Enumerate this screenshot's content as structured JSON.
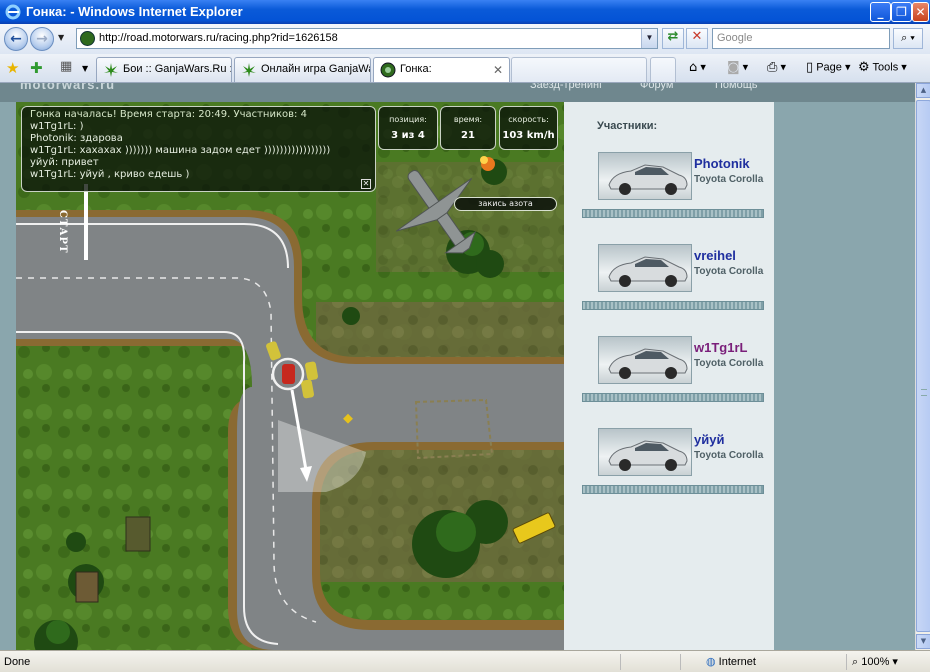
{
  "window": {
    "title": "Гонка: - Windows Internet Explorer"
  },
  "address": {
    "url": "http://road.motorwars.ru/racing.php?rid=1626158"
  },
  "search": {
    "placeholder": "Google"
  },
  "tabs": [
    {
      "label": "Бои :: GanjaWars.Ru ::...",
      "active": false
    },
    {
      "label": "Онлайн игра GanjaWa...",
      "active": false
    },
    {
      "label": "Гонка:",
      "active": true
    }
  ],
  "commands": {
    "page": "Page",
    "tools": "Tools"
  },
  "site": {
    "logo": "motorwars.ru",
    "links": [
      "Заезд-тренинг",
      "Форум",
      "Помощь"
    ]
  },
  "chat": {
    "lines": [
      "Гонка началась! Время старта: 20:49. Участников: 4",
      "w1Tg1rL: )",
      "Photonik: здарова",
      "w1Tg1rL: хахахах ))))))) машина задом едет )))))))))))))))))",
      "уйуй: привет",
      "w1Tg1rL: уйуй , криво едешь )"
    ]
  },
  "stats": {
    "position": {
      "label": "позиция:",
      "value": "3 из 4"
    },
    "time": {
      "label": "время:",
      "value": "21"
    },
    "speed": {
      "label": "скорость:",
      "value": "103 km/h"
    }
  },
  "nitro": {
    "label": "закись азота"
  },
  "track": {
    "start_label": "СТАРТ"
  },
  "participants": {
    "heading": "Участники:",
    "list": [
      {
        "name": "Photonik",
        "model": "Toyota Corolla",
        "name_color": "#1f2f9f"
      },
      {
        "name": "vreihel",
        "model": "Toyota Corolla",
        "name_color": "#1f2f9f"
      },
      {
        "name": "w1Tg1rL",
        "model": "Toyota Corolla",
        "name_color": "#7a1f7a"
      },
      {
        "name": "уйуй",
        "model": "Toyota Corolla",
        "name_color": "#1f2f9f"
      }
    ]
  },
  "statusbar": {
    "text": "Done",
    "zone": "Internet",
    "zoom": "100%"
  }
}
